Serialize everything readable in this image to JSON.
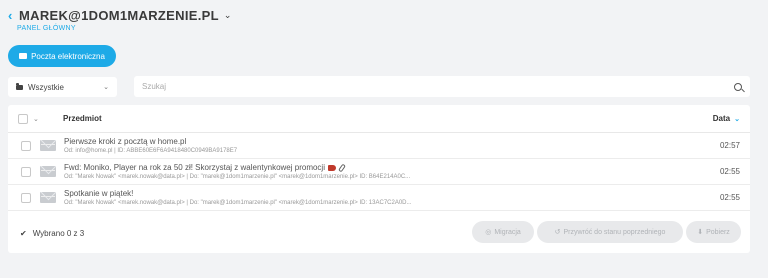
{
  "header": {
    "account": "MAREK@1DOM1MARZENIE.PL",
    "subtitle": "PANEL GŁÓWNY"
  },
  "actions": {
    "mail_button": "Poczta elektroniczna"
  },
  "folder": {
    "selected": "Wszystkie"
  },
  "search": {
    "placeholder": "Szukaj"
  },
  "table": {
    "col_subject": "Przedmiot",
    "col_date": "Data",
    "rows": [
      {
        "subject": "Pierwsze kroki z pocztą w home.pl",
        "meta": "Od: info@home.pl | ID: ABBE60E6F6A9418480C0949BA9178E7",
        "time": "02:57"
      },
      {
        "subject": "Fwd: Moniko, Player na rok za 50 zł! Skorzystaj z walentynkowej promocji",
        "meta": "Od: \"Marek Nowak\" <marek.nowak@data.pl> | Do: \"marek@1dom1marzenie.pl\" <marek@1dom1marzenie.pl> ID: B64E214A0C...",
        "time": "02:55"
      },
      {
        "subject": "Spotkanie w piątek!",
        "meta": "Od: \"Marek Nowak\" <marek.nowak@data.pl> | Do: \"marek@1dom1marzenie.pl\" <marek@1dom1marzenie.pl> ID: 13AC7C2A0D...",
        "time": "02:55"
      }
    ]
  },
  "footer": {
    "selected_text": "Wybrano 0 z 3",
    "btn_migration": "Migracja",
    "btn_move": "Przywróć do stanu poprzedniego",
    "btn_download": "Pobierz"
  },
  "colors": {
    "accent": "#1eaae7",
    "background": "#f2f3f5"
  }
}
